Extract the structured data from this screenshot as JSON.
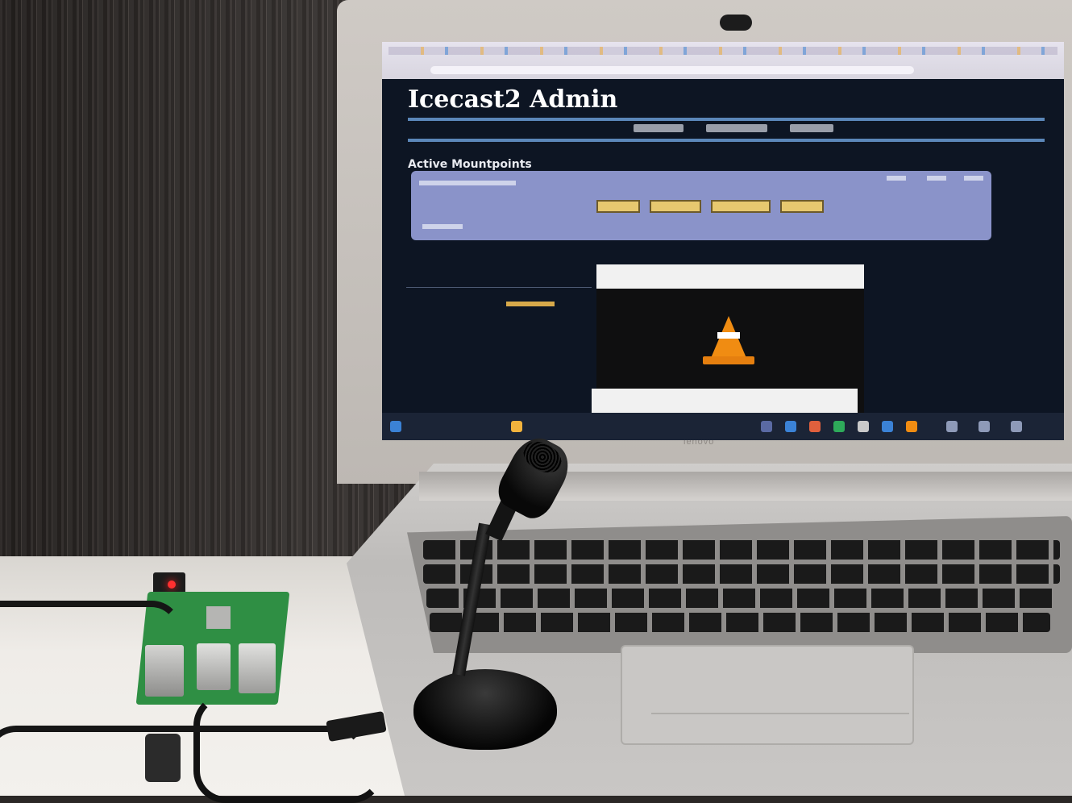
{
  "scene": {
    "description_items": [
      "laptop",
      "raspberry-pi-board",
      "usb-microphone",
      "cables"
    ],
    "laptop_brand": "lenovo"
  },
  "browser": {
    "page_title": "Icecast2 Admin",
    "section_heading": "Active Mountpoints"
  },
  "colors": {
    "page_background": "#0d1523",
    "nav_rule": "#5b87b9",
    "mount_box": "#8a93c9",
    "mount_buttons": "#e7c86f",
    "vlc_cone": "#f08c12",
    "pi_board": "#2f8f44"
  }
}
